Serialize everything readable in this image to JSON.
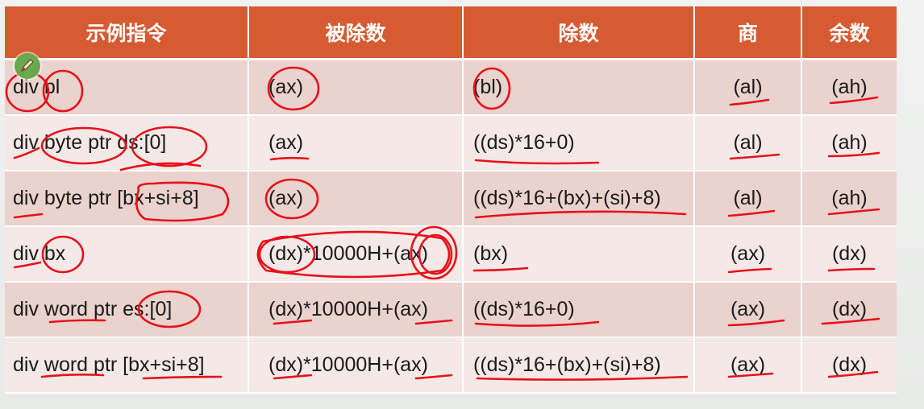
{
  "table": {
    "headers": [
      "示例指令",
      "被除数",
      "除数",
      "商",
      "余数"
    ],
    "rows": [
      {
        "instruction": "div bl",
        "dividend": "(ax)",
        "divisor": "(bl)",
        "quotient": "(al)",
        "remainder": "(ah)"
      },
      {
        "instruction": "div byte ptr ds:[0]",
        "dividend": "(ax)",
        "divisor": "((ds)*16+0)",
        "quotient": "(al)",
        "remainder": "(ah)"
      },
      {
        "instruction": "div byte ptr [bx+si+8]",
        "dividend": "(ax)",
        "divisor": "((ds)*16+(bx)+(si)+8)",
        "quotient": "(al)",
        "remainder": "(ah)"
      },
      {
        "instruction": "div bx",
        "dividend": "(dx)*10000H+(ax)",
        "divisor": "(bx)",
        "quotient": "(ax)",
        "remainder": "(dx)"
      },
      {
        "instruction": "div word ptr es:[0]",
        "dividend": "(dx)*10000H+(ax)",
        "divisor": "((ds)*16+0)",
        "quotient": "(ax)",
        "remainder": "(dx)"
      },
      {
        "instruction": "div word ptr [bx+si+8]",
        "dividend": "(dx)*10000H+(ax)",
        "divisor": "((ds)*16+(bx)+(si)+8)",
        "quotient": "(ax)",
        "remainder": "(dx)"
      }
    ]
  },
  "colors": {
    "header_bg": "#d65a32",
    "row_odd_bg": "#ead2cd",
    "row_even_bg": "#f4e9e7",
    "annotation_ink": "#e8101a",
    "pen_cursor": "#6aa84f"
  },
  "icons": {
    "pen_cursor": "pen-icon"
  }
}
